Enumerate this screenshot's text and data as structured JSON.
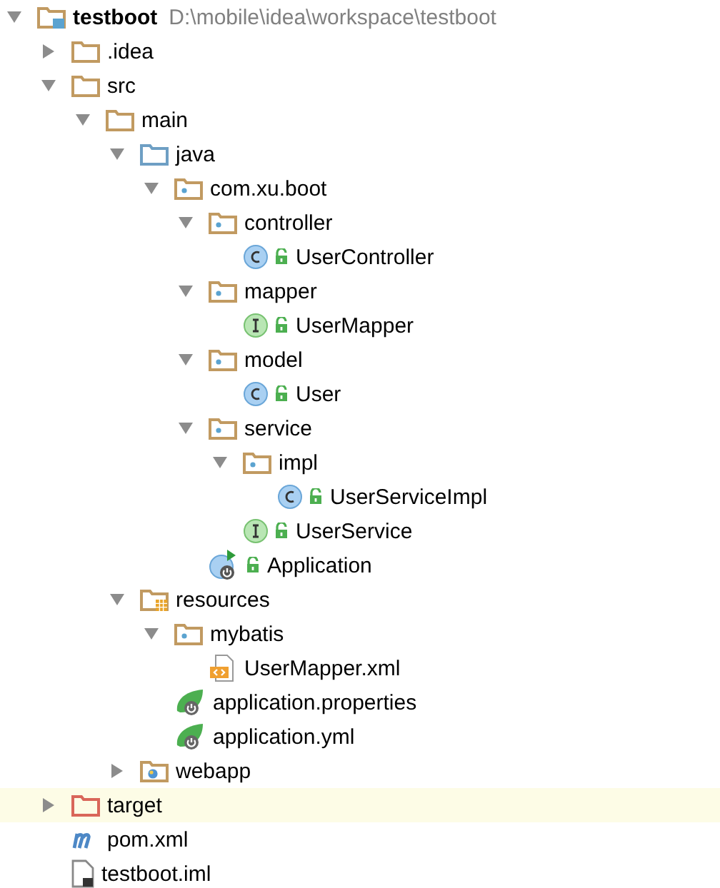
{
  "tree": [
    {
      "kind": "module",
      "label": "testboot",
      "path": "D:\\mobile\\idea\\workspace\\testboot",
      "expanded": true,
      "selected": false,
      "children": [
        {
          "kind": "folder",
          "label": ".idea",
          "expanded": false,
          "selected": false
        },
        {
          "kind": "folder",
          "label": "src",
          "expanded": true,
          "selected": false,
          "children": [
            {
              "kind": "folder",
              "label": "main",
              "expanded": true,
              "selected": false,
              "children": [
                {
                  "kind": "source-folder",
                  "label": "java",
                  "expanded": true,
                  "selected": false,
                  "children": [
                    {
                      "kind": "package",
                      "label": "com.xu.boot",
                      "expanded": true,
                      "selected": false,
                      "children": [
                        {
                          "kind": "package",
                          "label": "controller",
                          "expanded": true,
                          "selected": false,
                          "children": [
                            {
                              "kind": "class",
                              "label": "UserController",
                              "selected": false
                            }
                          ]
                        },
                        {
                          "kind": "package",
                          "label": "mapper",
                          "expanded": true,
                          "selected": false,
                          "children": [
                            {
                              "kind": "interface",
                              "label": "UserMapper",
                              "selected": false
                            }
                          ]
                        },
                        {
                          "kind": "package",
                          "label": "model",
                          "expanded": true,
                          "selected": false,
                          "children": [
                            {
                              "kind": "class",
                              "label": "User",
                              "selected": false
                            }
                          ]
                        },
                        {
                          "kind": "package",
                          "label": "service",
                          "expanded": true,
                          "selected": false,
                          "children": [
                            {
                              "kind": "package",
                              "label": "impl",
                              "expanded": true,
                              "selected": false,
                              "children": [
                                {
                                  "kind": "class",
                                  "label": "UserServiceImpl",
                                  "selected": false
                                }
                              ]
                            },
                            {
                              "kind": "interface",
                              "label": "UserService",
                              "selected": false
                            }
                          ]
                        },
                        {
                          "kind": "app",
                          "label": "Application",
                          "selected": false
                        }
                      ]
                    }
                  ]
                },
                {
                  "kind": "resources",
                  "label": "resources",
                  "expanded": true,
                  "selected": false,
                  "children": [
                    {
                      "kind": "package",
                      "label": "mybatis",
                      "expanded": true,
                      "selected": false,
                      "children": [
                        {
                          "kind": "xml",
                          "label": "UserMapper.xml",
                          "selected": false
                        }
                      ]
                    },
                    {
                      "kind": "spring",
                      "label": "application.properties",
                      "selected": false
                    },
                    {
                      "kind": "spring",
                      "label": "application.yml",
                      "selected": false
                    }
                  ]
                },
                {
                  "kind": "web",
                  "label": "webapp",
                  "expanded": false,
                  "selected": false
                }
              ]
            }
          ]
        },
        {
          "kind": "excluded",
          "label": "target",
          "expanded": false,
          "selected": true
        },
        {
          "kind": "maven",
          "label": "pom.xml",
          "selected": false
        },
        {
          "kind": "iml",
          "label": "testboot.iml",
          "selected": false
        }
      ]
    }
  ]
}
